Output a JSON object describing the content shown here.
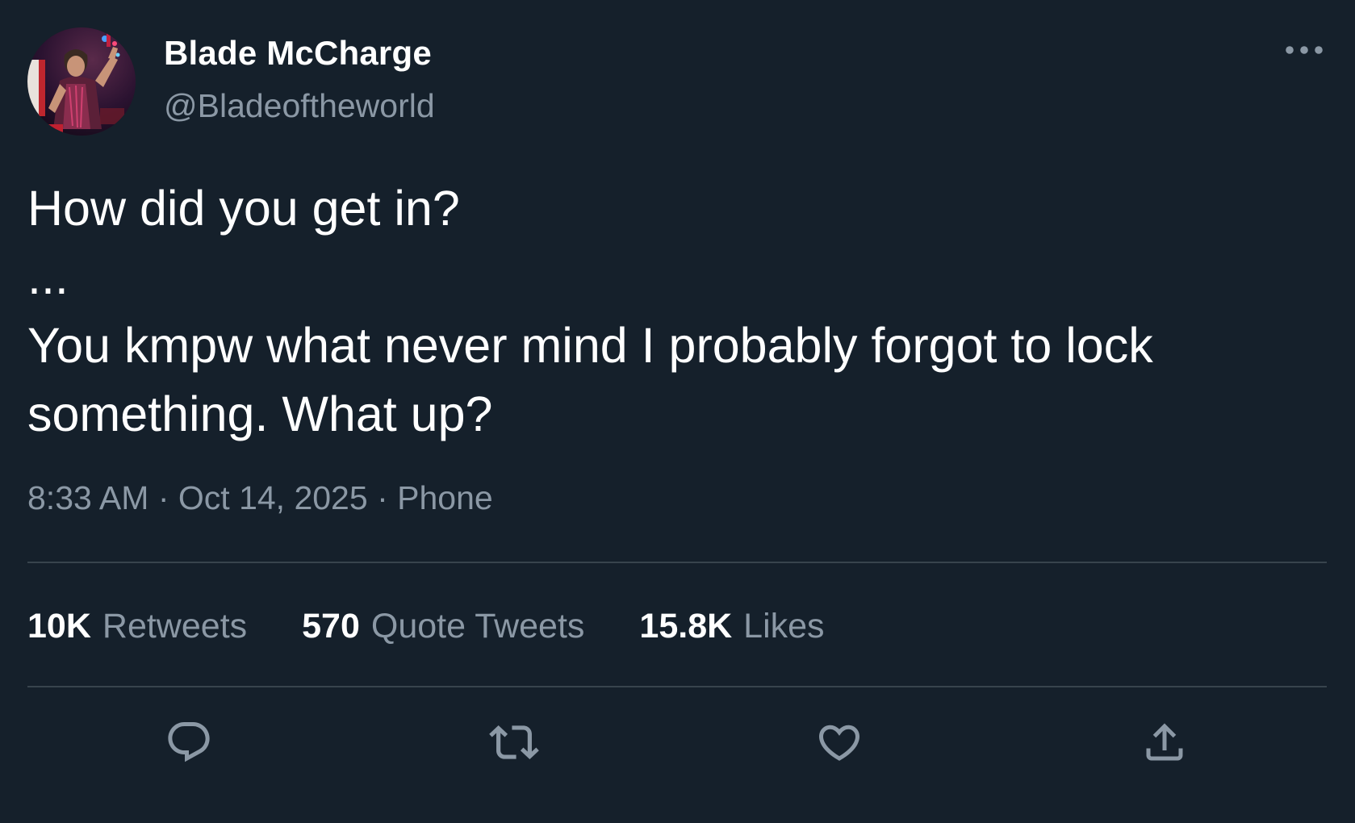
{
  "tweet": {
    "author": {
      "display_name": "Blade McCharge",
      "handle": "@Bladeoftheworld",
      "avatar_icon": "wrestler-avatar"
    },
    "text_lines": [
      "How did you get in?",
      "...",
      "You kmpw what never mind I probably forgot to lock",
      "something. What up?"
    ],
    "meta": {
      "time": "8:33 AM",
      "separator": "·",
      "date": "Oct 14, 2025",
      "source": "Phone"
    },
    "stats": [
      {
        "value": "10K",
        "label": "Retweets"
      },
      {
        "value": "570",
        "label": "Quote Tweets"
      },
      {
        "value": "15.8K",
        "label": "Likes"
      }
    ],
    "actions": [
      {
        "name": "reply",
        "icon": "reply-icon"
      },
      {
        "name": "retweet",
        "icon": "retweet-icon"
      },
      {
        "name": "like",
        "icon": "heart-icon"
      },
      {
        "name": "share",
        "icon": "share-icon"
      }
    ],
    "more_icon": "more-dots-icon"
  },
  "colors": {
    "background": "#15202b",
    "primary_text": "#ffffff",
    "secondary_text": "#8b98a5",
    "divider": "#38444d"
  }
}
